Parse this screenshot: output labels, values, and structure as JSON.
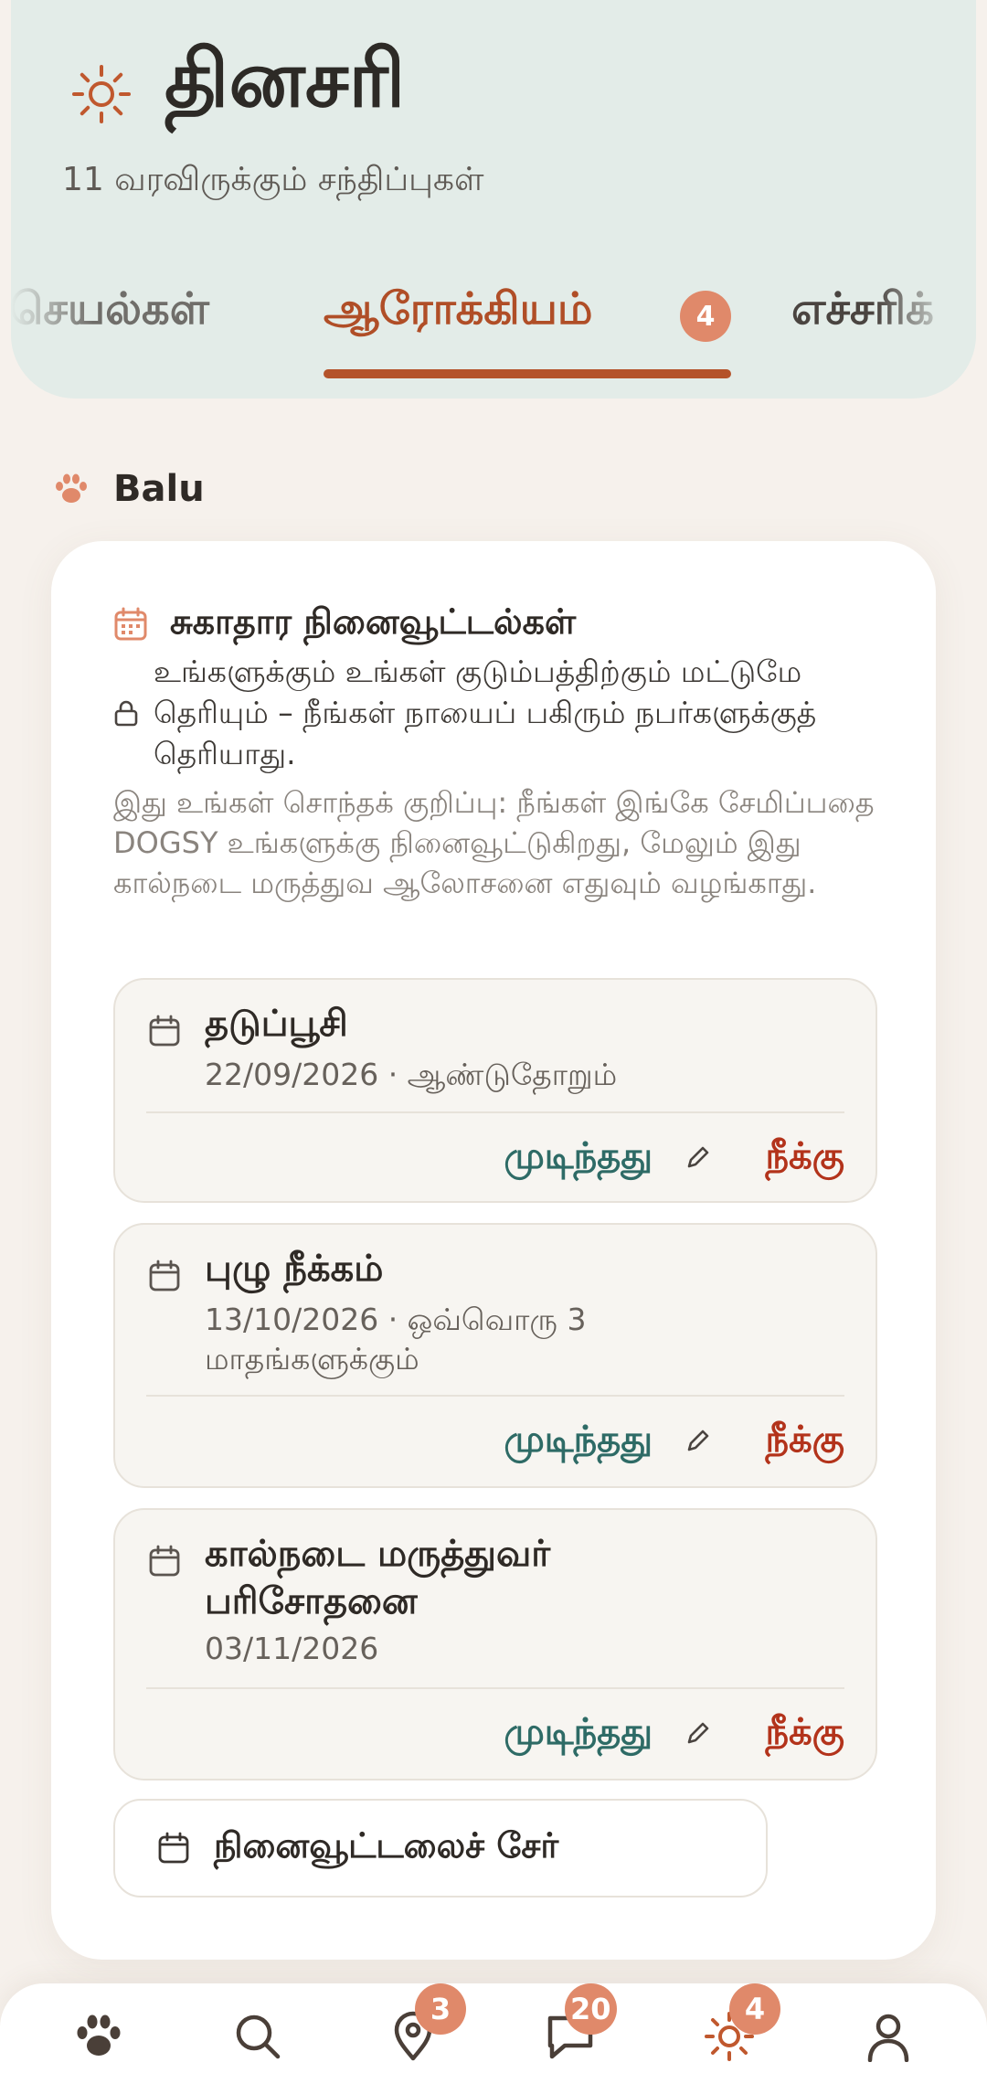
{
  "header": {
    "title": "தினசரி",
    "subtitle": "11 வரவிருக்கும் சந்திப்புகள்"
  },
  "tabs": [
    {
      "label": "செயல்கள்",
      "active": false
    },
    {
      "label": "ஆரோக்கியம்",
      "active": true,
      "badge": "4"
    },
    {
      "label": "எச்சரிக்",
      "active": false
    }
  ],
  "pet": {
    "name": "Balu"
  },
  "card": {
    "title": "சுகாதார நினைவூட்டல்கள்",
    "privacy_note": "உங்களுக்கும் உங்கள் குடும்பத்திற்கும் மட்டுமே தெரியும் – நீங்கள் நாயைப் பகிரும் நபர்களுக்குத் தெரியாது.",
    "disclaimer": "இது உங்கள் சொந்தக் குறிப்பு: நீங்கள் இங்கே சேமிப்பதை DOGSY உங்களுக்கு நினைவூட்டுகிறது, மேலும் இது கால்நடை மருத்துவ ஆலோசனை எதுவும் வழங்காது."
  },
  "reminders": [
    {
      "title": "தடுப்பூசி",
      "meta": "22/09/2026 · ஆண்டுதோறும்",
      "done_label": "முடிந்தது",
      "remove_label": "நீக்கு"
    },
    {
      "title": "புழு நீக்கம்",
      "meta": "13/10/2026 · ஒவ்வொரு 3 மாதங்களுக்கும்",
      "done_label": "முடிந்தது",
      "remove_label": "நீக்கு"
    },
    {
      "title": "கால்நடை மருத்துவர் பரிசோதனை",
      "meta": "03/11/2026",
      "done_label": "முடிந்தது",
      "remove_label": "நீக்கு"
    }
  ],
  "add_button": {
    "label": "நினைவூட்டலைச் சேர்"
  },
  "bottom_nav": {
    "items": [
      {
        "icon": "paw-icon",
        "badge": null
      },
      {
        "icon": "search-icon",
        "badge": null
      },
      {
        "icon": "map-pin-icon",
        "badge": "3"
      },
      {
        "icon": "chat-icon",
        "badge": "20"
      },
      {
        "icon": "sun-icon",
        "badge": "4"
      },
      {
        "icon": "profile-icon",
        "badge": null
      }
    ]
  },
  "colors": {
    "accent": "#b4532a",
    "badge": "#e0896a",
    "done": "#2e6b66",
    "remove": "#b3331b",
    "header_bg": "#e3ece8"
  }
}
